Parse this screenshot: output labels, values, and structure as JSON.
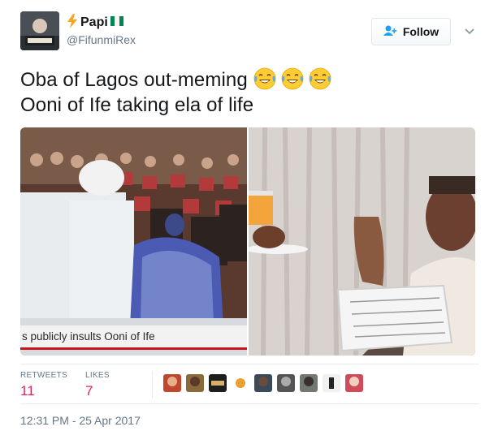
{
  "user": {
    "display_name": "Papi",
    "handle": "@FifunmiRex",
    "follow_label": "Follow"
  },
  "tweet": {
    "line1": "Oba of Lagos out-meming",
    "line2": "Ooni of Ife taking ela of life",
    "emoji": "😂😂😂"
  },
  "media": {
    "left_caption": "s publicly insults Ooni of Ife"
  },
  "stats": {
    "retweets_label": "RETWEETS",
    "retweets_value": "11",
    "likes_label": "LIKES",
    "likes_value": "7"
  },
  "timestamp": "12:31 PM - 25 Apr 2017",
  "colors": {
    "likes_red": "#e0245e",
    "muted": "#657786",
    "follow_blue": "#1da1f2",
    "flag_green": "#008751"
  }
}
